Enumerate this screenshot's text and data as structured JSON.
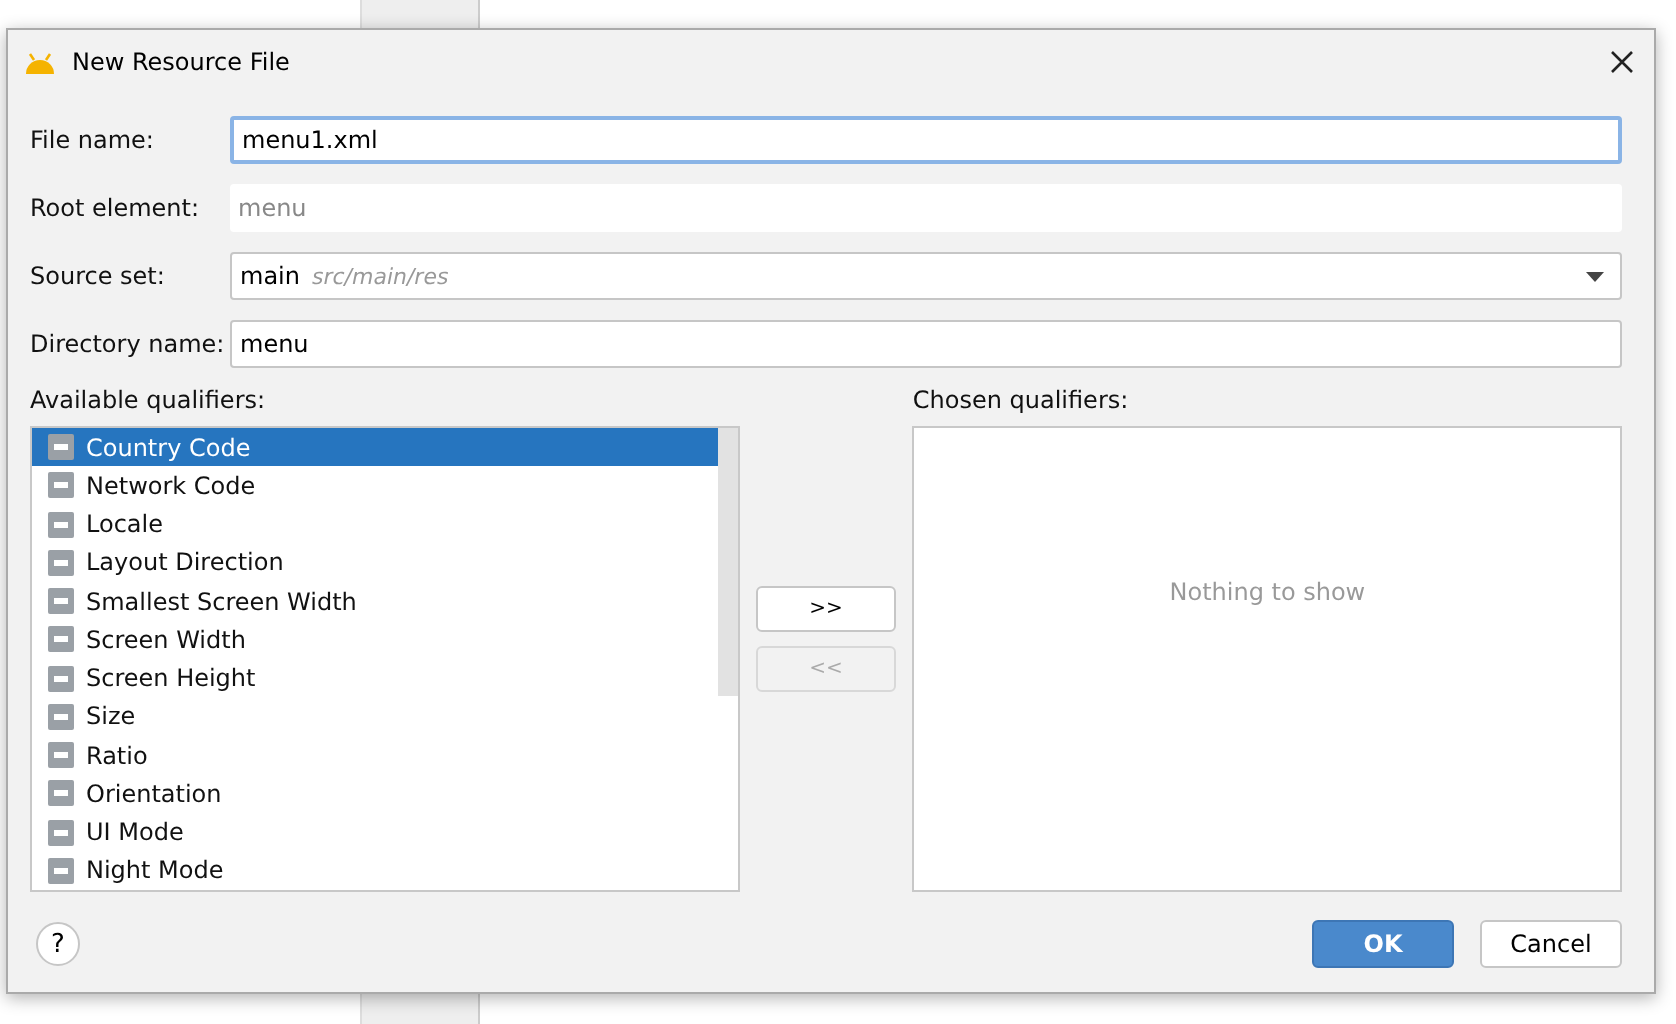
{
  "window": {
    "title": "New Resource File"
  },
  "fields": [
    {
      "kind": "text",
      "label": "File name:",
      "value": "menu1.xml",
      "focused": true
    },
    {
      "kind": "readonly",
      "label": "Root element:",
      "value": "menu"
    },
    {
      "kind": "dropdown",
      "label": "Source set:",
      "value": "main",
      "hint": "src/main/res"
    },
    {
      "kind": "text",
      "label": "Directory name:",
      "value": "menu",
      "focused": false
    }
  ],
  "available": {
    "label": "Available qualifiers:",
    "items": [
      {
        "label": "Country Code",
        "selected": true
      },
      {
        "label": "Network Code",
        "selected": false
      },
      {
        "label": "Locale",
        "selected": false
      },
      {
        "label": "Layout Direction",
        "selected": false
      },
      {
        "label": "Smallest Screen Width",
        "selected": false
      },
      {
        "label": "Screen Width",
        "selected": false
      },
      {
        "label": "Screen Height",
        "selected": false
      },
      {
        "label": "Size",
        "selected": false
      },
      {
        "label": "Ratio",
        "selected": false
      },
      {
        "label": "Orientation",
        "selected": false
      },
      {
        "label": "UI Mode",
        "selected": false
      },
      {
        "label": "Night Mode",
        "selected": false
      }
    ]
  },
  "move_buttons": [
    {
      "label": ">>",
      "disabled": false
    },
    {
      "label": "<<",
      "disabled": true
    }
  ],
  "chosen": {
    "label": "Chosen qualifiers:",
    "empty_text": "Nothing to show"
  },
  "help": {
    "label": "?"
  },
  "buttons": [
    {
      "label": "OK",
      "default": true
    },
    {
      "label": "Cancel",
      "default": false
    }
  ]
}
